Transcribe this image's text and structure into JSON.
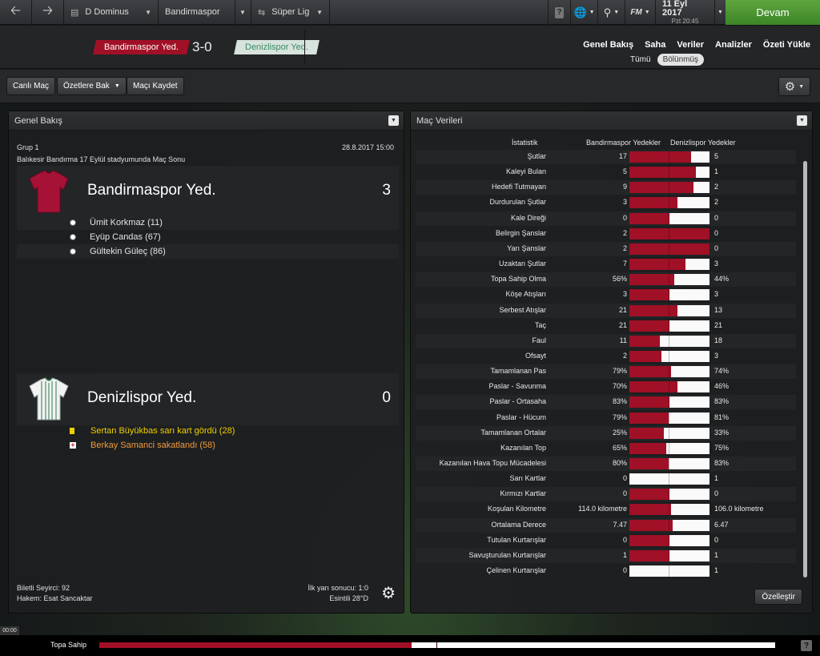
{
  "topbar": {
    "manager": "D Dominus",
    "club": "Bandirmaspor",
    "competition": "Süper Lig",
    "date": "11 Eyl 2017",
    "day_time": "Pzt 20:45",
    "continue_label": "Devam",
    "fm_label": "FM",
    "help_label": "?"
  },
  "header": {
    "home_team": "Bandirmaspor Yed.",
    "score": "3-0",
    "away_team": "Denizlispor Yed.",
    "nav": [
      "Genel Bakış",
      "Saha",
      "Veriler",
      "Analizler",
      "Özeti Yükle"
    ],
    "sub_all": "Tümü",
    "sub_split": "Bölünmüş"
  },
  "toolbar": {
    "live": "Canlı Maç",
    "highlights": "Özetlere Bak",
    "save": "Maçı Kaydet"
  },
  "overview": {
    "title": "Genel Bakış",
    "group": "Grup 1",
    "datetime": "28.8.2017 15:00",
    "venue": "Balıkesir Bandırma 17 Eylül stadyumunda Maç Sonu",
    "home": {
      "name": "Bandirmaspor Yed.",
      "score": "3",
      "scorers": [
        "Ümit Korkmaz (11)",
        "Eyüp Candas (67)",
        "Gültekin Güleç (86)"
      ]
    },
    "away": {
      "name": "Denizlispor Yed.",
      "score": "0",
      "events": [
        "Sertan Büyükbas sarı kart gördü (28)",
        "Berkay Samanci sakatlandı (58)"
      ]
    },
    "attendance": "Biletli Seyirci: 92",
    "referee": "Hakem: Esat Sancaktar",
    "halftime": "İlk yarı sonucu: 1:0",
    "weather": "Esintili 28°D"
  },
  "stats": {
    "title": "Maç Verileri",
    "col_stat": "İstatistik",
    "col_home": "Bandirmaspor Yedekler",
    "col_away": "Denizlispor Yedekler",
    "customize": "Özelleştir",
    "rows": [
      {
        "label": "Şutlar",
        "home": "17",
        "away": "5",
        "share": 0.77
      },
      {
        "label": "Kaleyi Bulan",
        "home": "5",
        "away": "1",
        "share": 0.83
      },
      {
        "label": "Hedefi Tutmayan",
        "home": "9",
        "away": "2",
        "share": 0.8
      },
      {
        "label": "Durdurulan Şutlar",
        "home": "3",
        "away": "2",
        "share": 0.6
      },
      {
        "label": "Kale Direği",
        "home": "0",
        "away": "0",
        "share": 0.5
      },
      {
        "label": "Belirgin Şanslar",
        "home": "2",
        "away": "0",
        "share": 1.0
      },
      {
        "label": "Yarı Şanslar",
        "home": "2",
        "away": "0",
        "share": 1.0
      },
      {
        "label": "Uzaktan Şutlar",
        "home": "7",
        "away": "3",
        "share": 0.7
      },
      {
        "label": "Topa Sahip Olma",
        "home": "56%",
        "away": "44%",
        "share": 0.56
      },
      {
        "label": "Köşe Atışları",
        "home": "3",
        "away": "3",
        "share": 0.5
      },
      {
        "label": "Serbest Atışlar",
        "home": "21",
        "away": "13",
        "share": 0.6
      },
      {
        "label": "Taç",
        "home": "21",
        "away": "21",
        "share": 0.5
      },
      {
        "label": "Faul",
        "home": "11",
        "away": "18",
        "share": 0.38
      },
      {
        "label": "Ofsayt",
        "home": "2",
        "away": "3",
        "share": 0.4
      },
      {
        "label": "Tamamlanan Pas",
        "home": "79%",
        "away": "74%",
        "share": 0.52
      },
      {
        "label": "Paslar - Savunma",
        "home": "70%",
        "away": "46%",
        "share": 0.6
      },
      {
        "label": "Paslar - Ortasaha",
        "home": "83%",
        "away": "83%",
        "share": 0.5
      },
      {
        "label": "Paslar - Hücum",
        "home": "79%",
        "away": "81%",
        "share": 0.49
      },
      {
        "label": "Tamamlanan Ortalar",
        "home": "25%",
        "away": "33%",
        "share": 0.43
      },
      {
        "label": "Kazanılan Top",
        "home": "65%",
        "away": "75%",
        "share": 0.46
      },
      {
        "label": "Kazanılan Hava Topu Mücadelesi",
        "home": "80%",
        "away": "83%",
        "share": 0.49
      },
      {
        "label": "Sarı Kartlar",
        "home": "0",
        "away": "1",
        "share": 0.0
      },
      {
        "label": "Kırmızı Kartlar",
        "home": "0",
        "away": "0",
        "share": 0.5
      },
      {
        "label": "Koşulan Kilometre",
        "home": "114.0 kilometre",
        "away": "106.0 kilometre",
        "share": 0.52
      },
      {
        "label": "Ortalama Derece",
        "home": "7.47",
        "away": "6.47",
        "share": 0.54
      },
      {
        "label": "Tutulan Kurtarışlar",
        "home": "0",
        "away": "0",
        "share": 0.5
      },
      {
        "label": "Savuşturulan Kurtarışlar",
        "home": "1",
        "away": "1",
        "share": 0.5
      },
      {
        "label": "Çelinen Kurtarışlar",
        "home": "0",
        "away": "1",
        "share": 0.0
      }
    ]
  },
  "bottom": {
    "time": "00:00",
    "possession_label": "Topa Sahip",
    "possession_home": 0.56
  },
  "colors": {
    "home": "#a01026",
    "continue": "#4f9a34"
  }
}
